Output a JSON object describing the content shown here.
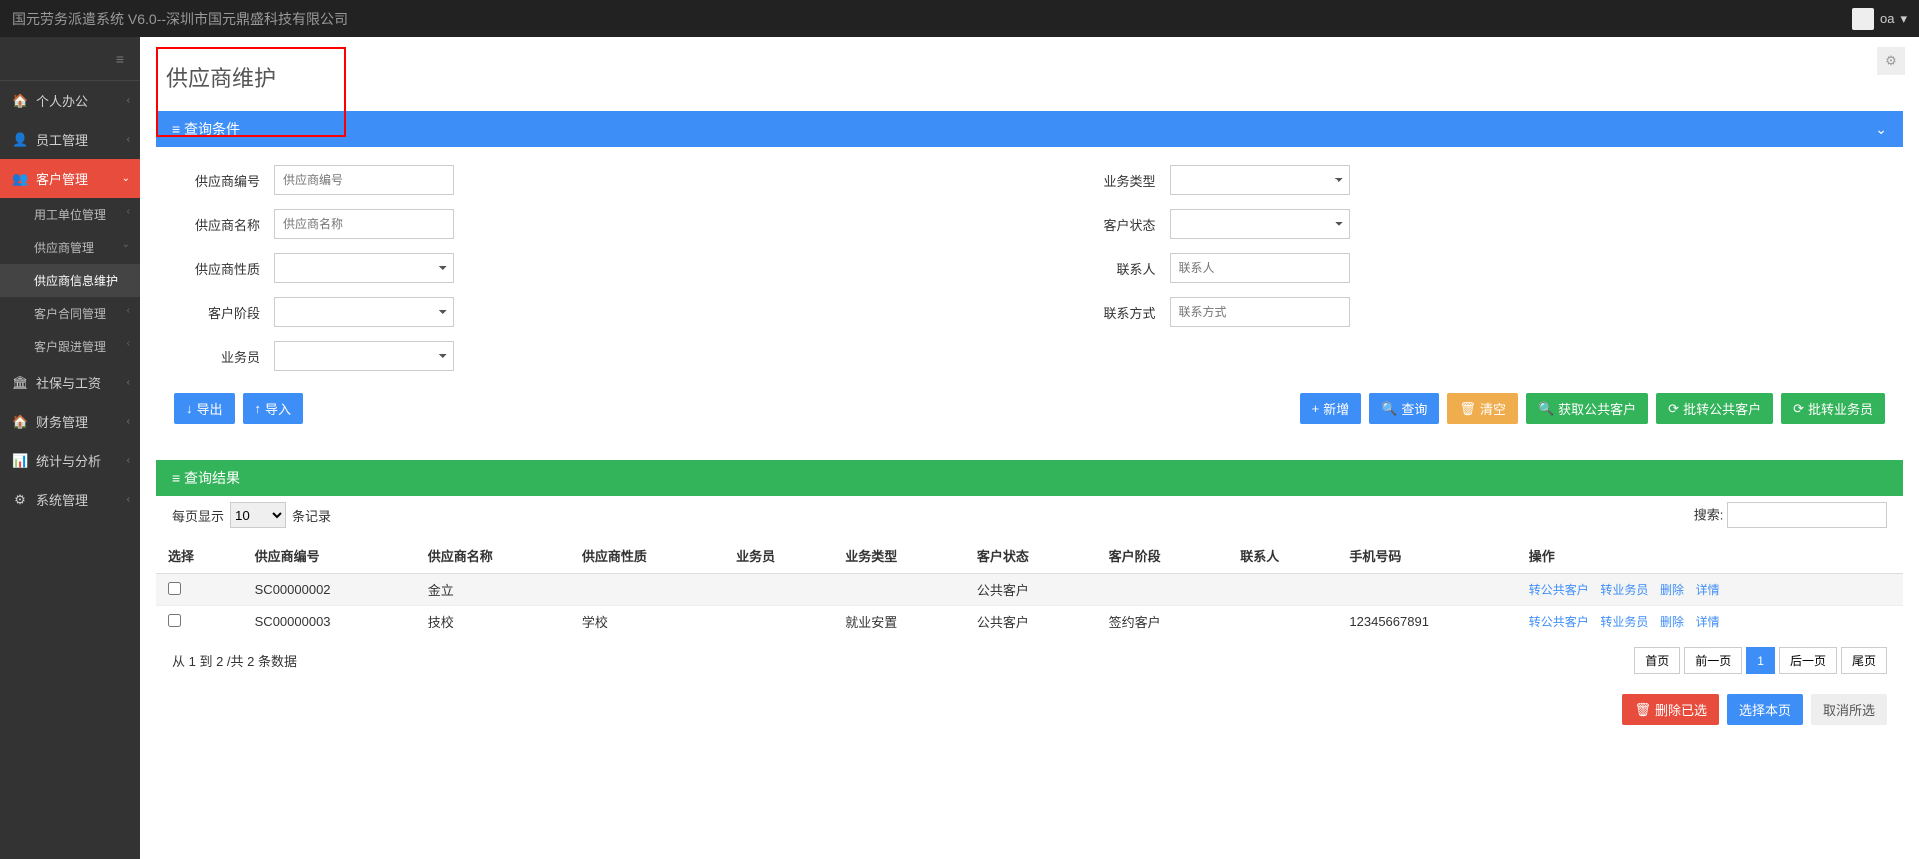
{
  "app": {
    "title": "国元劳务派遣系统 V6.0--深圳市国元鼎盛科技有限公司",
    "username": "oa"
  },
  "sidebar": {
    "items": [
      {
        "icon": "🏠",
        "label": "个人办公",
        "chev": "‹"
      },
      {
        "icon": "👤",
        "label": "员工管理",
        "chev": "‹"
      },
      {
        "icon": "👥",
        "label": "客户管理",
        "chev": "⌄",
        "active": true
      },
      {
        "icon": "🏛",
        "label": "社保与工资",
        "chev": "‹"
      },
      {
        "icon": "🏠",
        "label": "财务管理",
        "chev": "‹"
      },
      {
        "icon": "📊",
        "label": "统计与分析",
        "chev": "‹"
      },
      {
        "icon": "⚙",
        "label": "系统管理",
        "chev": "‹"
      }
    ],
    "subitems": [
      {
        "label": "用工单位管理",
        "chev": "‹"
      },
      {
        "label": "供应商管理",
        "chev": "⌄"
      },
      {
        "label": "供应商信息维护",
        "highlighted": true
      },
      {
        "label": "客户合同管理",
        "chev": "‹"
      },
      {
        "label": "客户跟进管理",
        "chev": "‹"
      }
    ]
  },
  "page": {
    "title": "供应商维护",
    "filter_header": "≡ 查询条件",
    "result_header": "≡ 查询结果",
    "collapse_icon": "⌄"
  },
  "form": {
    "supplier_code_label": "供应商编号",
    "supplier_code_ph": "供应商编号",
    "supplier_name_label": "供应商名称",
    "supplier_name_ph": "供应商名称",
    "supplier_nature_label": "供应商性质",
    "customer_stage_label": "客户阶段",
    "salesman_label": "业务员",
    "biz_type_label": "业务类型",
    "cust_status_label": "客户状态",
    "contact_label": "联系人",
    "contact_ph": "联系人",
    "contact_way_label": "联系方式",
    "contact_way_ph": "联系方式"
  },
  "buttons": {
    "export": "导出",
    "import": "导入",
    "add": "新增",
    "query": "查询",
    "clear": "清空",
    "get_public": "获取公共客户",
    "to_public": "批转公共客户",
    "to_salesman": "批转业务员",
    "delete_selected": "删除已选",
    "select_page": "选择本页",
    "deselect_all": "取消所选"
  },
  "table": {
    "per_page_label": "每页显示",
    "records_label": "条记录",
    "per_page_value": "10",
    "search_label": "搜索:",
    "cols": [
      "选择",
      "供应商编号",
      "供应商名称",
      "供应商性质",
      "业务员",
      "业务类型",
      "客户状态",
      "客户阶段",
      "联系人",
      "手机号码",
      "操作"
    ],
    "rows": [
      {
        "code": "SC00000002",
        "name": "金立",
        "nature": "",
        "salesman": "",
        "biztype": "",
        "status": "公共客户",
        "stage": "",
        "contact": "",
        "phone": ""
      },
      {
        "code": "SC00000003",
        "name": "技校",
        "nature": "学校",
        "salesman": "",
        "biztype": "就业安置",
        "status": "公共客户",
        "stage": "签约客户",
        "contact": "",
        "phone": "12345667891"
      }
    ],
    "row_actions": {
      "to_public": "转公共客户",
      "to_sales": "转业务员",
      "delete": "删除",
      "detail": "详情"
    },
    "footer_info": "从 1 到 2 /共 2 条数据",
    "pager": {
      "first": "首页",
      "prev": "前一页",
      "current": "1",
      "next": "后一页",
      "last": "尾页"
    }
  }
}
